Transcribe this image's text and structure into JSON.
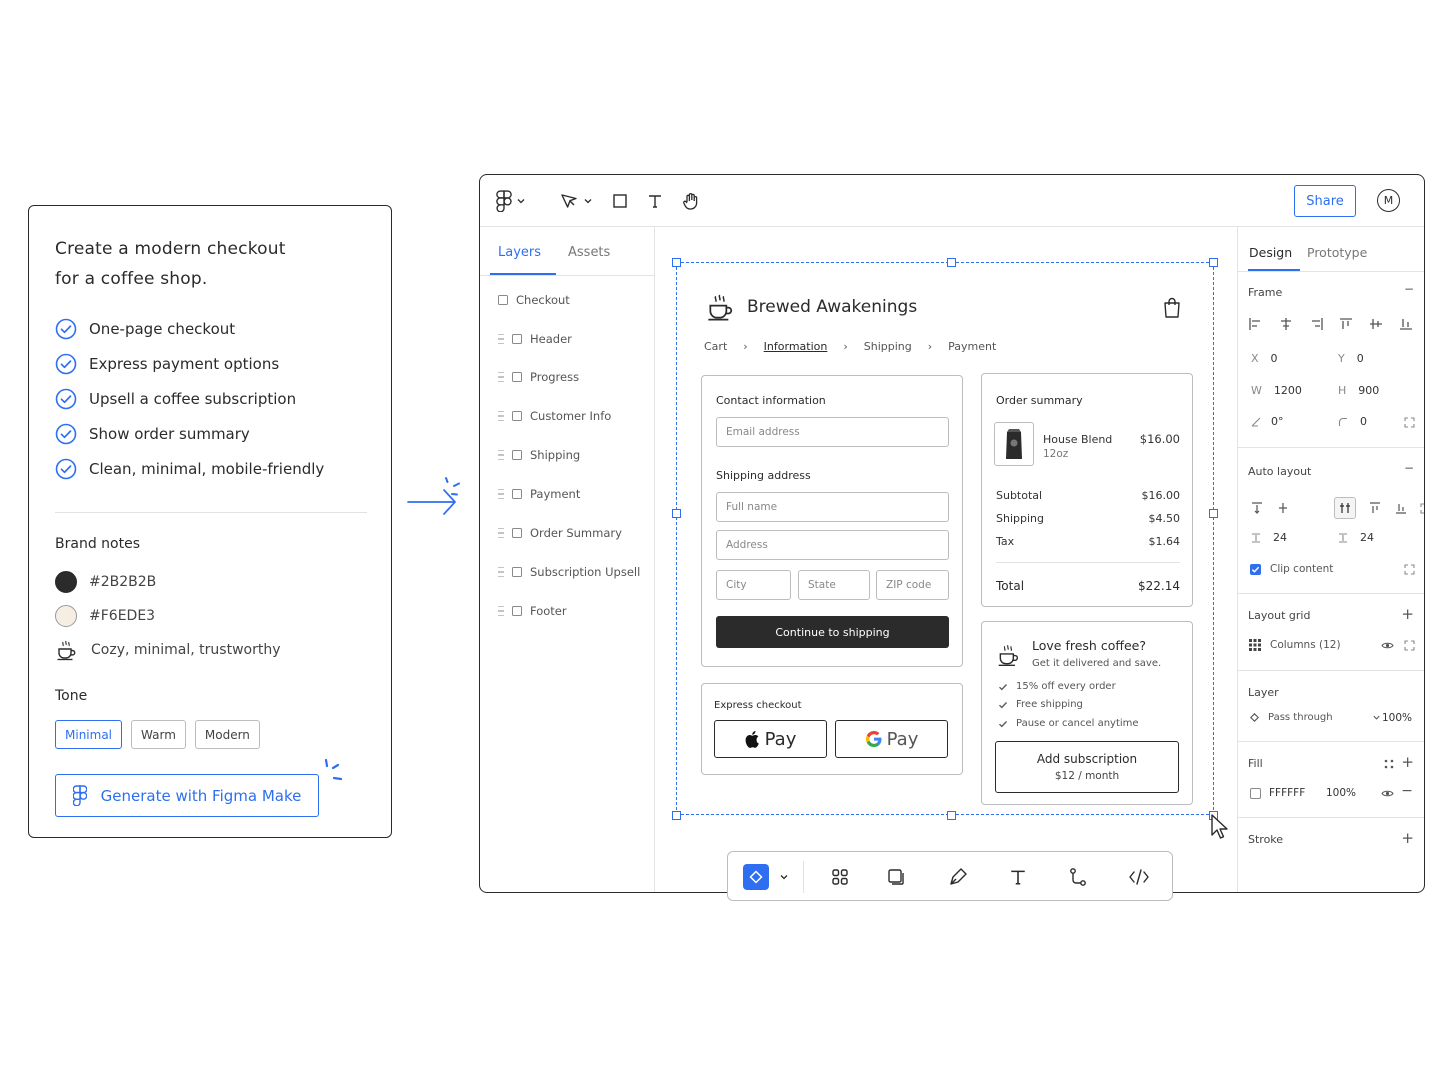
{
  "prompt": {
    "title_line1": "Create a modern checkout",
    "title_line2": "for a coffee shop.",
    "requirements": [
      "One-page checkout",
      "Express payment options",
      "Upsell a coffee subscription",
      "Show order summary",
      "Clean, minimal, mobile-friendly"
    ],
    "brand_notes_heading": "Brand notes",
    "brand_colors": [
      {
        "hex_label": "#2B2B2B",
        "color": "#2B2B2B"
      },
      {
        "hex_label": "#F6EDE3",
        "color": "#F6EDE3"
      }
    ],
    "brand_mood": "Cozy, minimal, trustworthy",
    "tone_heading": "Tone",
    "tones": [
      "Minimal",
      "Warm",
      "Modern"
    ],
    "active_tone": "Minimal",
    "generate_label": "Generate with Figma Make",
    "accent_color": "#2D6FF0"
  },
  "toolbar": {
    "share_label": "Share",
    "avatar_initial": "M"
  },
  "left_panel": {
    "tabs": [
      "Layers",
      "Assets"
    ],
    "root_layer": "Checkout",
    "layers": [
      "Header",
      "Progress",
      "Customer Info",
      "Shipping",
      "Payment",
      "Order Summary",
      "Subscription Upsell",
      "Footer"
    ]
  },
  "checkout": {
    "brand_name": "Brewed Awakenings",
    "breadcrumbs": [
      "Cart",
      "Information",
      "Shipping",
      "Payment"
    ],
    "current_step": "Information",
    "contact_heading": "Contact information",
    "email_placeholder": "Email address",
    "shipping_heading": "Shipping address",
    "full_name_placeholder": "Full name",
    "address_placeholder": "Address",
    "city_placeholder": "City",
    "state_placeholder": "State",
    "zip_placeholder": "ZIP code",
    "continue_label": "Continue to shipping",
    "express_heading": "Express checkout",
    "apple_pay_label": "Pay",
    "google_pay_label": "Pay",
    "order_summary": {
      "heading": "Order summary",
      "item_name": "House Blend",
      "item_size": "12oz",
      "item_price": "$16.00",
      "rows": [
        {
          "label": "Subtotal",
          "value": "$16.00"
        },
        {
          "label": "Shipping",
          "value": "$4.50"
        },
        {
          "label": "Tax",
          "value": "$1.64"
        }
      ],
      "total_label": "Total",
      "total_value": "$22.14"
    },
    "upsell": {
      "heading": "Love fresh coffee?",
      "subheading": "Get it delivered and save.",
      "benefits": [
        "15% off every order",
        "Free shipping",
        "Pause or cancel anytime"
      ],
      "button_line1": "Add subscription",
      "button_line2": "$12 / month"
    }
  },
  "right_panel": {
    "tabs": [
      "Design",
      "Prototype"
    ],
    "frame_heading": "Frame",
    "x_label": "X",
    "x_value": "0",
    "y_label": "Y",
    "y_value": "0",
    "w_label": "W",
    "w_value": "1200",
    "h_label": "H",
    "h_value": "900",
    "rotation_value": "0°",
    "radius_value": "0",
    "auto_layout_heading": "Auto layout",
    "gap_value": "24",
    "padding_value": "24",
    "clip_content_label": "Clip content",
    "layout_grid_heading": "Layout grid",
    "grid_label": "Columns (12)",
    "layer_heading": "Layer",
    "blend_mode": "Pass through",
    "layer_opacity": "100%",
    "fill_heading": "Fill",
    "fill_hex": "FFFFFF",
    "fill_opacity": "100%",
    "stroke_heading": "Stroke"
  }
}
